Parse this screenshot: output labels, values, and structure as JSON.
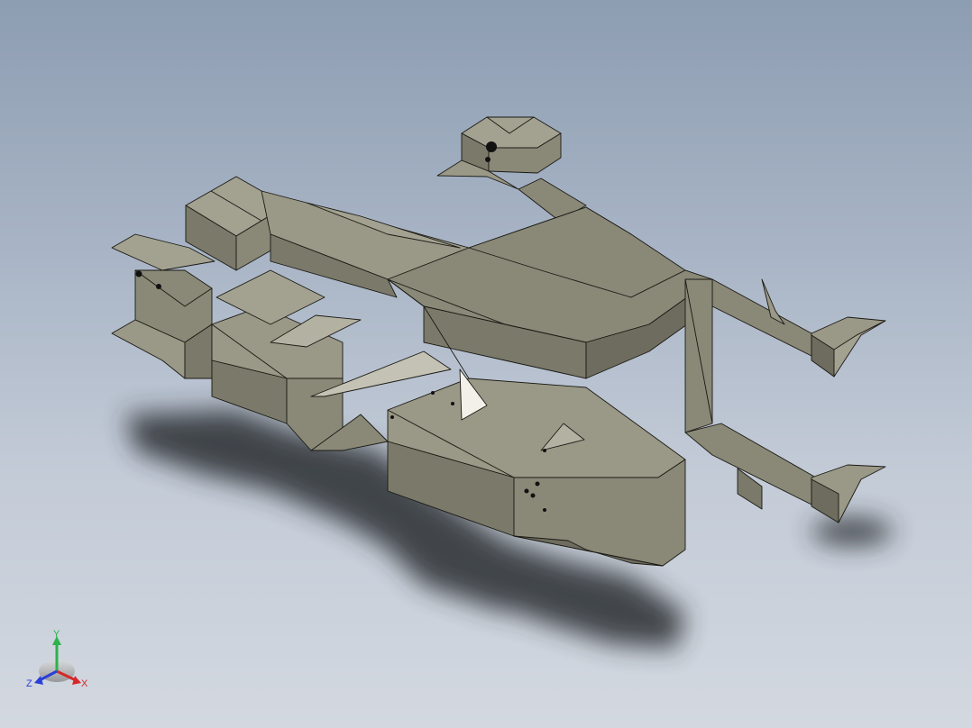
{
  "viewport": {
    "background_top": "#8d9db2",
    "background_bottom": "#d3d8e0",
    "model_face_color": "#8a8877",
    "model_face_light": "#a3a190",
    "model_face_dark": "#6e6c5e",
    "edge_color": "#1a1a14",
    "shadow_color": "#2a2d33"
  },
  "triad": {
    "x_label": "X",
    "y_label": "Y",
    "z_label": "Z",
    "x_color": "#d62828",
    "y_color": "#2bb24c",
    "z_color": "#2a3fd8"
  }
}
